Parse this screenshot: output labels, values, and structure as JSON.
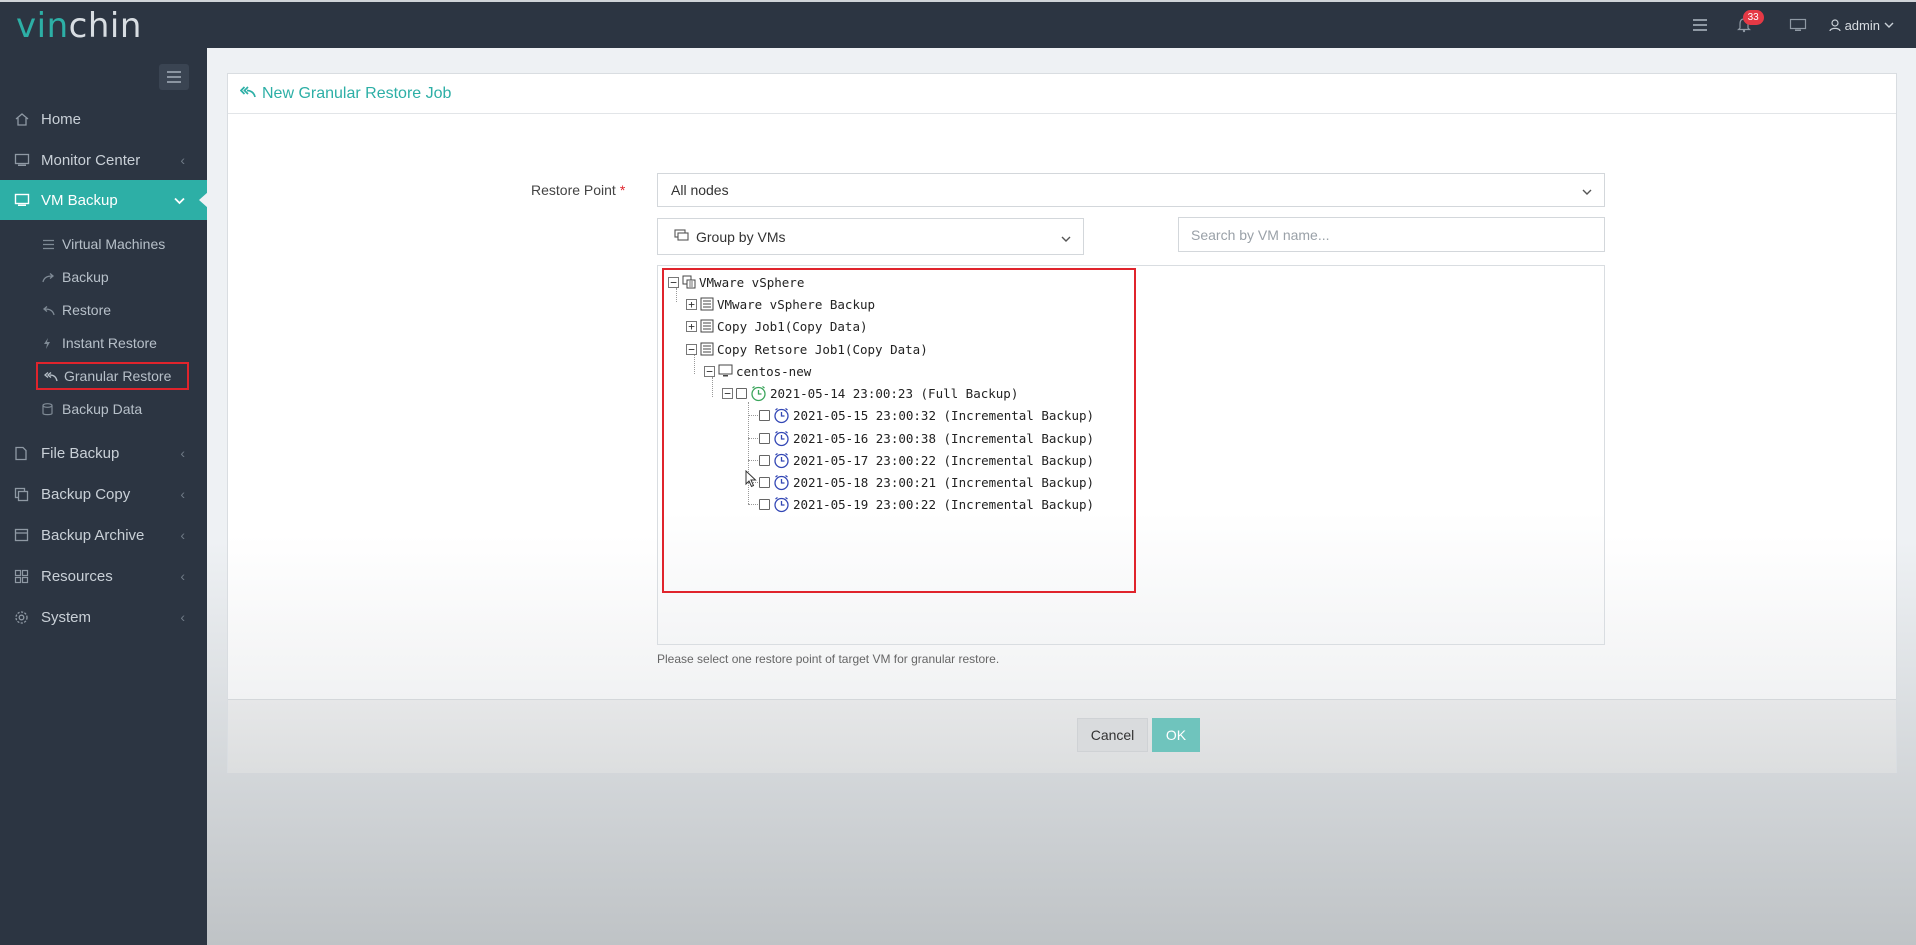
{
  "app": {
    "logo_part1": "vin",
    "logo_part2": "chin",
    "notification_count": "33",
    "user": "admin"
  },
  "sidebar": {
    "items": [
      {
        "label": "Home",
        "icon": "home-icon"
      },
      {
        "label": "Monitor Center",
        "icon": "monitor-icon"
      },
      {
        "label": "VM Backup",
        "icon": "vm-icon"
      },
      {
        "label": "File Backup",
        "icon": "file-icon"
      },
      {
        "label": "Backup Copy",
        "icon": "copy-icon"
      },
      {
        "label": "Backup Archive",
        "icon": "archive-icon"
      },
      {
        "label": "Resources",
        "icon": "resources-icon"
      },
      {
        "label": "System",
        "icon": "gear-icon"
      }
    ],
    "subitems": [
      {
        "label": "Virtual Machines"
      },
      {
        "label": "Backup"
      },
      {
        "label": "Restore"
      },
      {
        "label": "Instant Restore"
      },
      {
        "label": "Granular Restore"
      },
      {
        "label": "Backup Data"
      }
    ]
  },
  "page": {
    "title": "New Granular Restore Job",
    "restore_point_label": "Restore Point",
    "required_mark": "*",
    "nodes_select": "All nodes",
    "group_select": "Group by VMs",
    "search_placeholder": "Search by VM name...",
    "hint": "Please select one restore point of target VM for granular restore.",
    "cancel": "Cancel",
    "ok": "OK"
  },
  "tree": {
    "root": "VMware vSphere",
    "jobs": [
      "VMware vSphere Backup",
      "Copy Job1(Copy Data)",
      "Copy Retsore Job1(Copy Data)"
    ],
    "vm": "centos-new",
    "full_backup": "2021-05-14 23:00:23 (Full Backup)",
    "incrementals": [
      "2021-05-15 23:00:32 (Incremental Backup)",
      "2021-05-16 23:00:38 (Incremental Backup)",
      "2021-05-17 23:00:22 (Incremental Backup)",
      "2021-05-18 23:00:21 (Incremental Backup)",
      "2021-05-19 23:00:22 (Incremental Backup)"
    ]
  },
  "colors": {
    "accent": "#2dafa6",
    "sidebar_bg": "#2c3542",
    "highlight_red": "#e0242c"
  }
}
